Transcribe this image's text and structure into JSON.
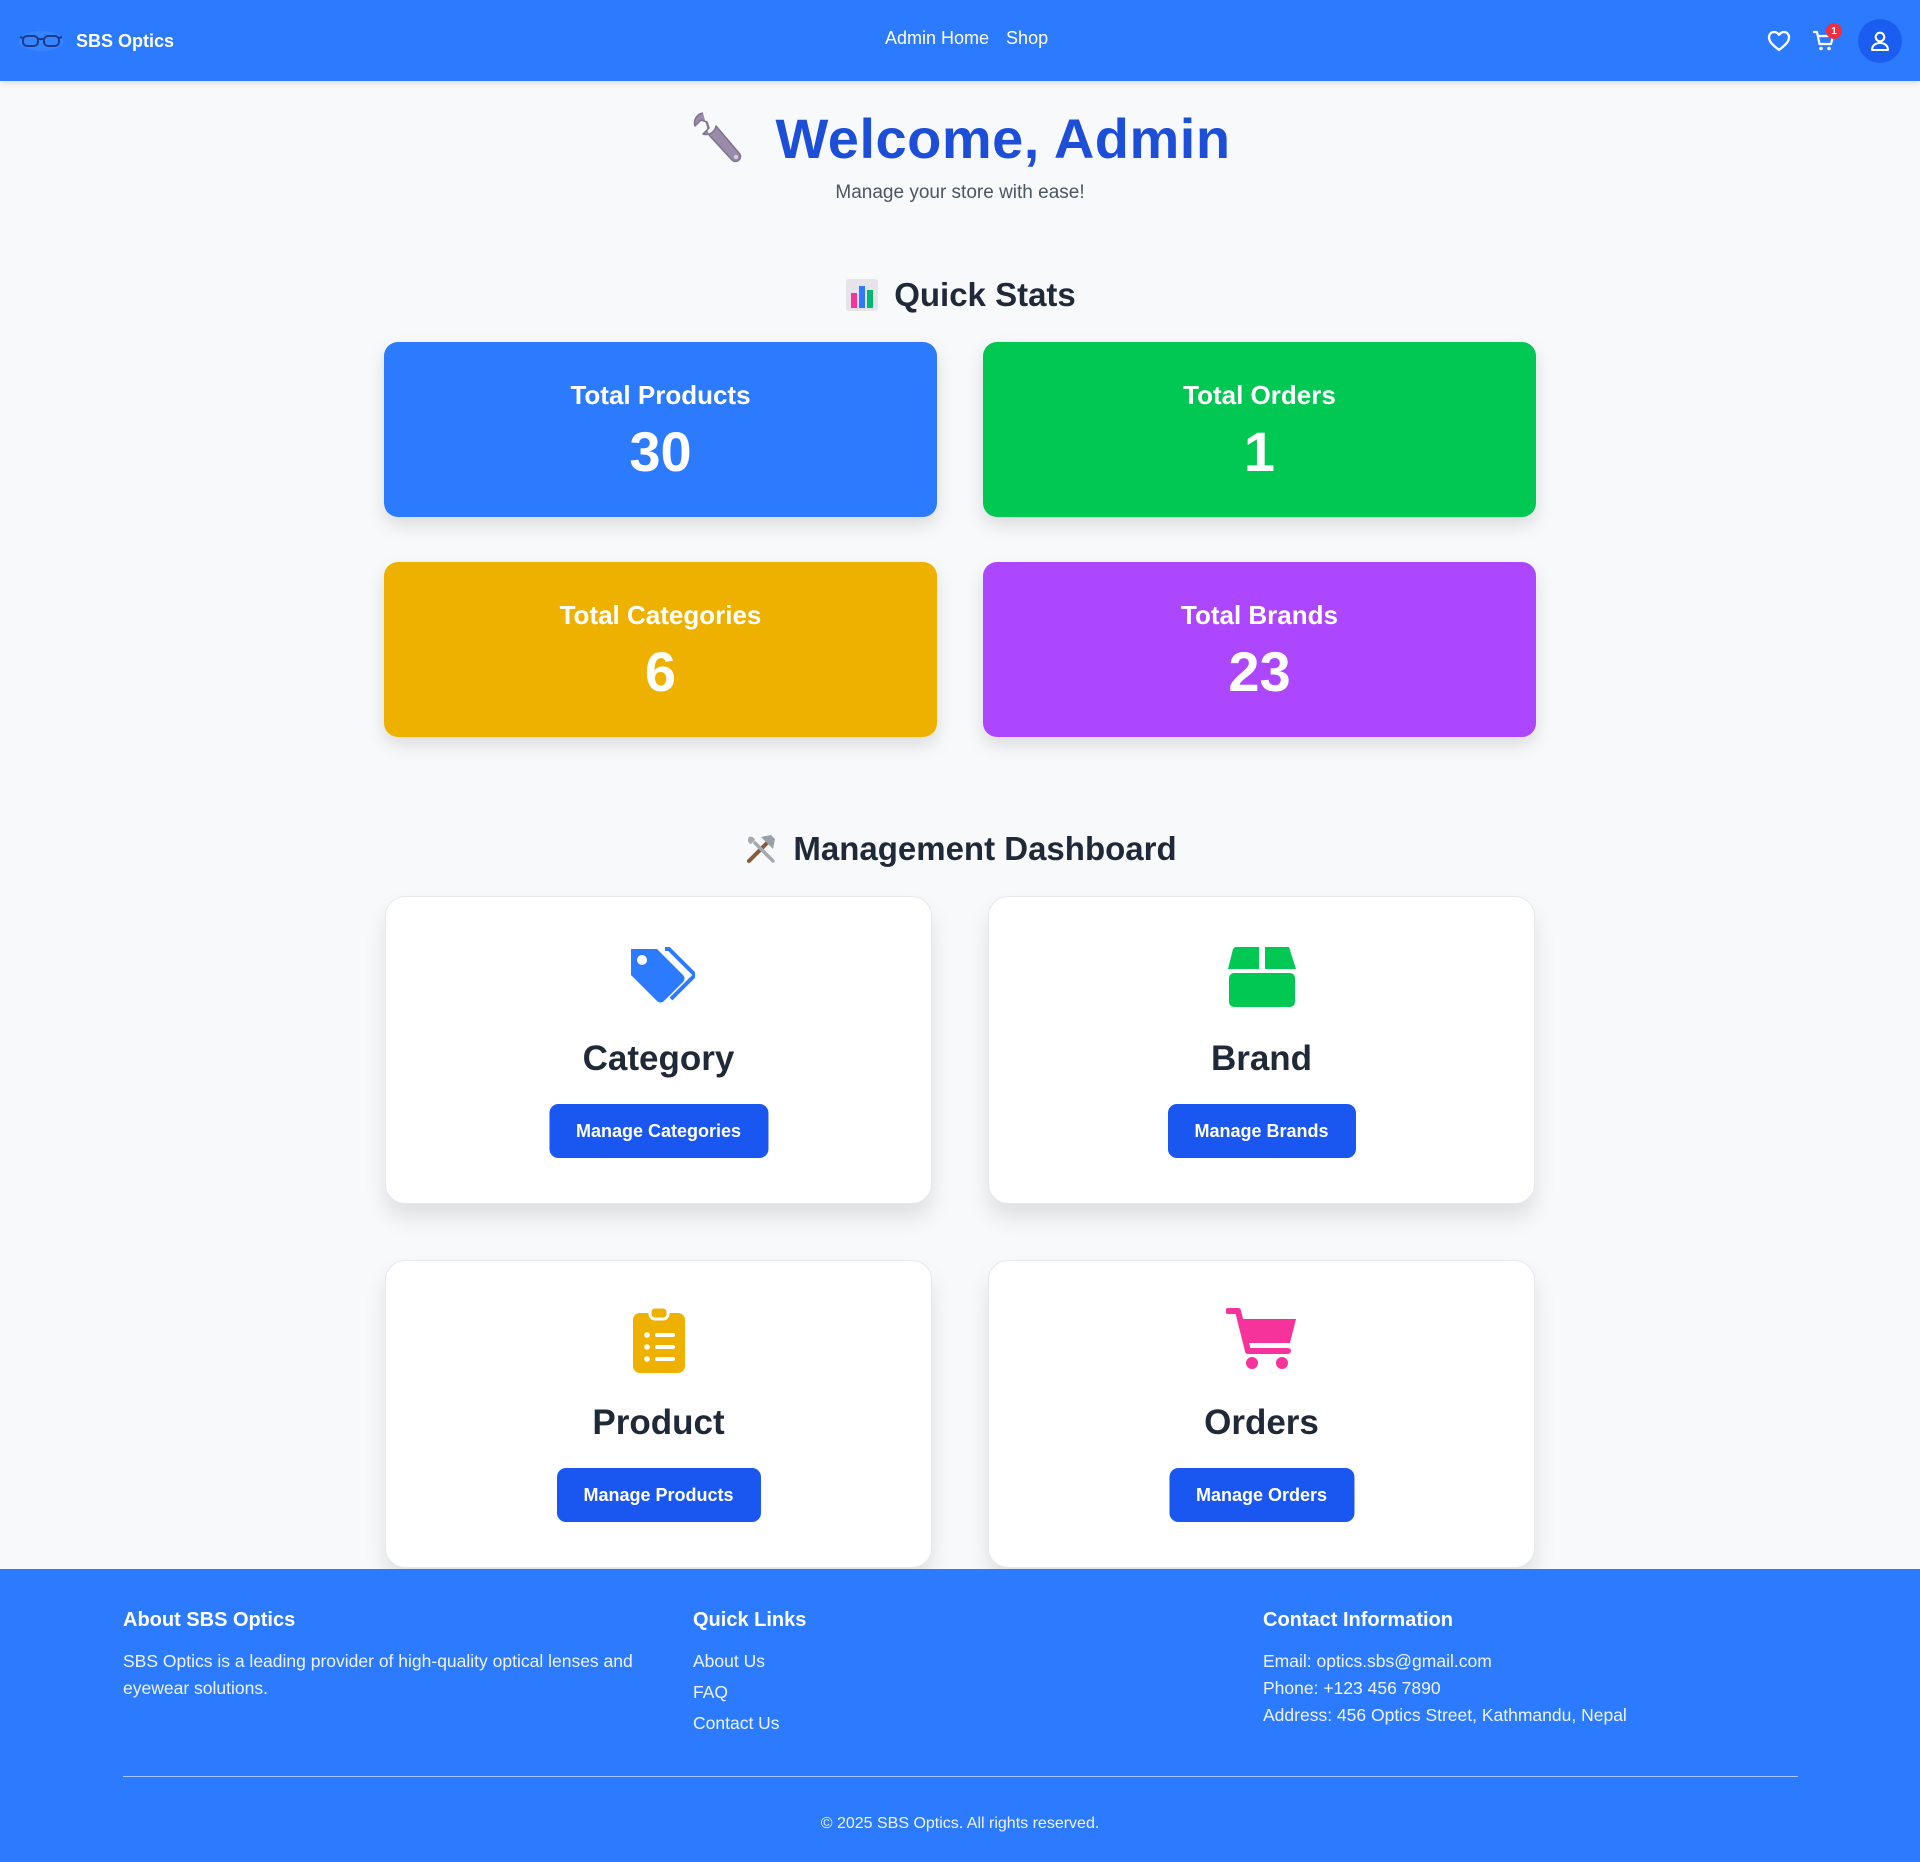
{
  "navbar": {
    "brand_name": "SBS Optics",
    "links": [
      "Admin Home",
      "Shop"
    ],
    "cart_count": "1",
    "icons": [
      "glasses-logo-icon",
      "heart-icon",
      "cart-icon",
      "user-icon"
    ]
  },
  "hero": {
    "title": "Welcome, Admin",
    "subtitle": "Manage your store with ease!",
    "icon": "wrench-icon"
  },
  "stats": {
    "title": "Quick Stats",
    "icon": "bar-chart-icon",
    "cards": [
      {
        "label": "Total Products",
        "value": "30",
        "color": "#2c7bff"
      },
      {
        "label": "Total Orders",
        "value": "1",
        "color": "#00c853"
      },
      {
        "label": "Total Categories",
        "value": "6",
        "color": "#efb100"
      },
      {
        "label": "Total Brands",
        "value": "23",
        "color": "#ad46ff"
      }
    ]
  },
  "management": {
    "title": "Management Dashboard",
    "icon": "hammer-wrench-icon",
    "cards": [
      {
        "title": "Category",
        "button": "Manage Categories",
        "icon": "tags-icon",
        "icon_color": "#2c7bff"
      },
      {
        "title": "Brand",
        "button": "Manage Brands",
        "icon": "box-icon",
        "icon_color": "#00c853"
      },
      {
        "title": "Product",
        "button": "Manage Products",
        "icon": "clipboard-list-icon",
        "icon_color": "#efb100"
      },
      {
        "title": "Orders",
        "button": "Manage Orders",
        "icon": "shopping-cart-icon",
        "icon_color": "#f6339a"
      }
    ]
  },
  "footer": {
    "about_heading": "About SBS Optics",
    "about_text": "SBS Optics is a leading provider of high-quality optical lenses and eyewear solutions.",
    "links_heading": "Quick Links",
    "links": [
      "About Us",
      "FAQ",
      "Contact Us"
    ],
    "contact_heading": "Contact Information",
    "email": "Email: optics.sbs@gmail.com",
    "phone": "Phone: +123 456 7890",
    "address": "Address: 456 Optics Street, Kathmandu, Nepal",
    "copyright": "© 2025 SBS Optics. All rights reserved."
  }
}
